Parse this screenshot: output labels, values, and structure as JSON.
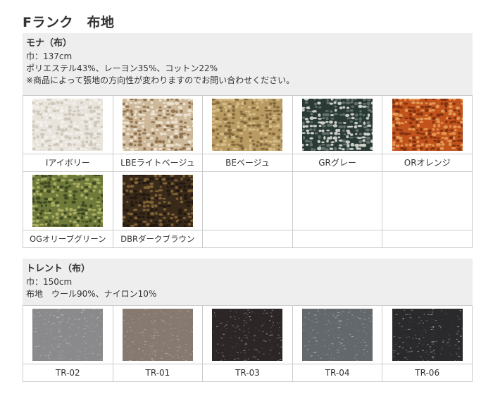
{
  "rank_title": "Fランク　布地",
  "sections": [
    {
      "name": "モナ（布）",
      "width": "巾：137cm",
      "composition": "ポリエステル43%、レーヨン35%、コットン22%",
      "note": "※商品によって張地の方向性が変わりますのでお問い合わせください。",
      "swatches": [
        {
          "label": "Iアイボリー",
          "colors": [
            "#e8e4dc",
            "#c9c2b4",
            "#f4f2ee"
          ]
        },
        {
          "label": "LBEライトベージュ",
          "colors": [
            "#cdb89a",
            "#8a6a45",
            "#efe6d6"
          ]
        },
        {
          "label": "BEベージュ",
          "colors": [
            "#b89a62",
            "#7b6237",
            "#d8c28e"
          ]
        },
        {
          "label": "GRグレー",
          "colors": [
            "#2a3a35",
            "#e6e6e2",
            "#6d7a74"
          ]
        },
        {
          "label": "ORオレンジ",
          "colors": [
            "#c2531c",
            "#7a2e0f",
            "#e8a25c"
          ]
        },
        {
          "label": "OGオリーブグリーン",
          "colors": [
            "#6e7a3a",
            "#3a4220",
            "#b3b56a"
          ]
        },
        {
          "label": "DBRダークブラウン",
          "colors": [
            "#3a2a1a",
            "#1e1610",
            "#8a6a3a"
          ]
        }
      ]
    },
    {
      "name": "トレント（布）",
      "width": "巾：150cm",
      "composition": "布地　ウール90%、ナイロン10%",
      "swatches": [
        {
          "label": "TR-02",
          "colors": [
            "#8a8a8c",
            "#a0a0a2"
          ]
        },
        {
          "label": "TR-01",
          "colors": [
            "#867a70",
            "#9b8f84"
          ]
        },
        {
          "label": "TR-03",
          "colors": [
            "#2c2726",
            "#3f3836"
          ]
        },
        {
          "label": "TR-04",
          "colors": [
            "#62686b",
            "#7c8285"
          ]
        },
        {
          "label": "TR-06",
          "colors": [
            "#2a2a2d",
            "#3c3c40"
          ]
        }
      ]
    }
  ]
}
